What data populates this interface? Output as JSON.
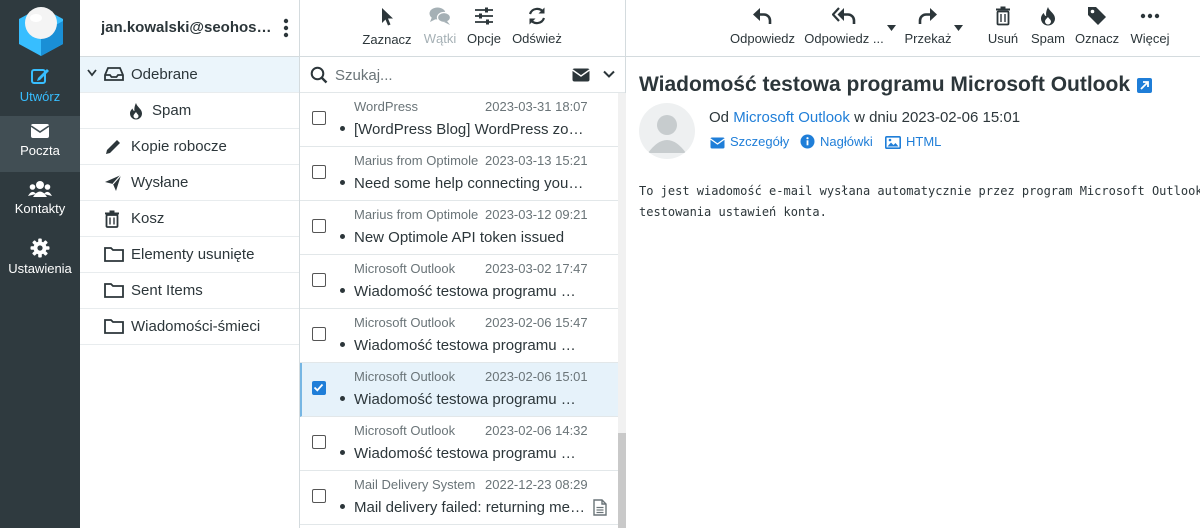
{
  "rail": {
    "compose": "Utwórz",
    "mail": "Poczta",
    "contacts": "Kontakty",
    "settings": "Ustawienia"
  },
  "account": {
    "email": "jan.kowalski@seohost.edu.pl"
  },
  "folders": [
    {
      "label": "Odebrane",
      "icon": "inbox-icon"
    },
    {
      "label": "Spam",
      "icon": "fire-icon"
    },
    {
      "label": "Kopie robocze",
      "icon": "pencil-icon"
    },
    {
      "label": "Wysłane",
      "icon": "paper-plane-icon"
    },
    {
      "label": "Kosz",
      "icon": "trash-icon"
    },
    {
      "label": "Elementy usunięte",
      "icon": "folder-icon"
    },
    {
      "label": "Sent Items",
      "icon": "folder-icon"
    },
    {
      "label": "Wiadomości-śmieci",
      "icon": "folder-icon"
    }
  ],
  "list_toolbar": {
    "select": "Zaznacz",
    "threads": "Wątki",
    "options": "Opcje",
    "refresh": "Odśwież"
  },
  "search": {
    "placeholder": "Szukaj..."
  },
  "messages": [
    {
      "sender": "WordPress",
      "date": "2023-03-31 18:07",
      "subject": "[WordPress Blog] WordPress została zaktualizowana",
      "checked": false
    },
    {
      "sender": "Marius from Optimole",
      "date": "2023-03-13 15:21",
      "subject": "Need some help connecting your site?",
      "checked": false
    },
    {
      "sender": "Marius from Optimole",
      "date": "2023-03-12 09:21",
      "subject": "New Optimole API token issued",
      "checked": false
    },
    {
      "sender": "Microsoft Outlook",
      "date": "2023-03-02 17:47",
      "subject": "Wiadomość testowa programu Microsoft Outlook",
      "checked": false
    },
    {
      "sender": "Microsoft Outlook",
      "date": "2023-02-06 15:47",
      "subject": "Wiadomość testowa programu Microsoft Outlook",
      "checked": false
    },
    {
      "sender": "Microsoft Outlook",
      "date": "2023-02-06 15:01",
      "subject": "Wiadomość testowa programu Microsoft Outlook",
      "checked": true
    },
    {
      "sender": "Microsoft Outlook",
      "date": "2023-02-06 14:32",
      "subject": "Wiadomość testowa programu Microsoft Outlook",
      "checked": false
    },
    {
      "sender": "Mail Delivery System",
      "date": "2022-12-23 08:29",
      "subject": "Mail delivery failed: returning message to sender",
      "checked": false
    }
  ],
  "pane_toolbar": {
    "reply": "Odpowiedz",
    "reply_all": "Odpowiedz ...",
    "forward": "Przekaż",
    "delete": "Usuń",
    "spam": "Spam",
    "mark": "Oznacz",
    "more": "Więcej"
  },
  "message": {
    "subject": "Wiadomość testowa programu Microsoft Outlook",
    "from_prefix": "Od",
    "from_name": "Microsoft Outlook",
    "date_line": "w dniu 2023-02-06 15:01",
    "details": "Szczegóły",
    "headers": "Nagłówki",
    "html": "HTML",
    "body": "To jest wiadomość e-mail wysłana automatycznie przez program Microsoft Outlook\ntestowania ustawień konta."
  },
  "colors": {
    "accent": "#1f7ed8",
    "rail": "#2f3a3f",
    "compose": "#37beff"
  }
}
